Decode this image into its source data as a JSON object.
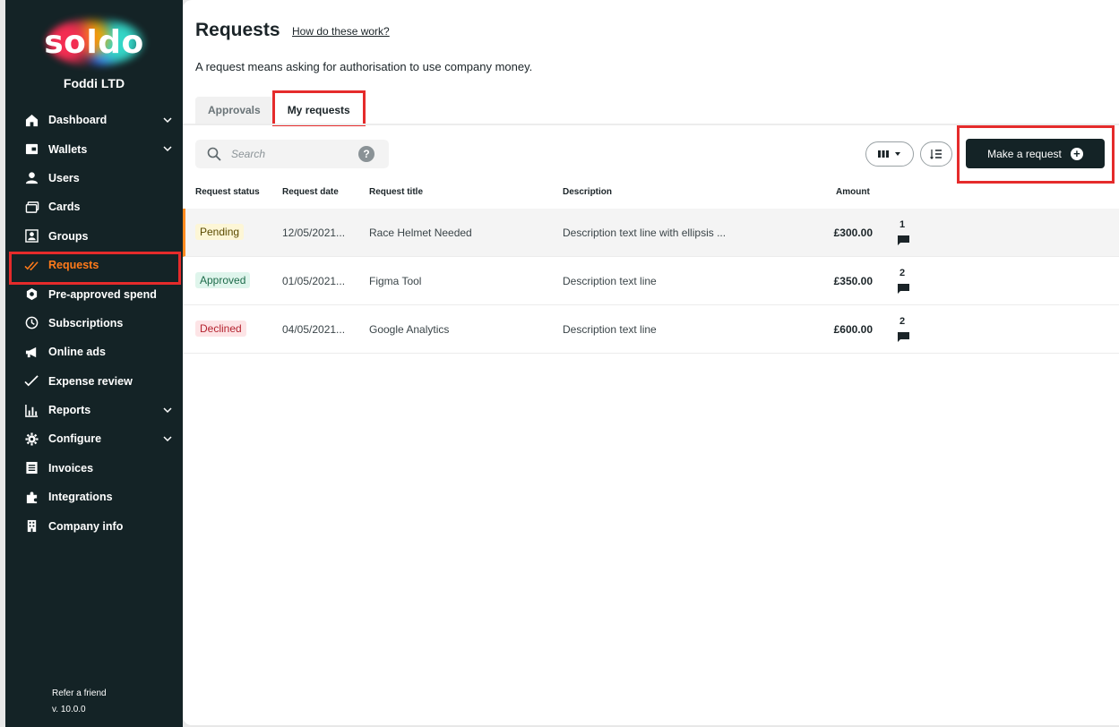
{
  "brand": {
    "logo_text": "soldo",
    "company": "Foddi LTD"
  },
  "sidebar": {
    "items": [
      {
        "label": "Dashboard",
        "icon": "home-icon",
        "has_chevron": true
      },
      {
        "label": "Wallets",
        "icon": "wallet-icon",
        "has_chevron": true
      },
      {
        "label": "Users",
        "icon": "user-icon",
        "has_chevron": false
      },
      {
        "label": "Cards",
        "icon": "cards-icon",
        "has_chevron": false
      },
      {
        "label": "Groups",
        "icon": "groups-icon",
        "has_chevron": false
      },
      {
        "label": "Requests",
        "icon": "double-check-icon",
        "has_chevron": false,
        "active": true
      },
      {
        "label": "Pre-approved spend",
        "icon": "hexagon-icon",
        "has_chevron": false
      },
      {
        "label": "Subscriptions",
        "icon": "clock-icon",
        "has_chevron": false
      },
      {
        "label": "Online ads",
        "icon": "megaphone-icon",
        "has_chevron": false
      },
      {
        "label": "Expense review",
        "icon": "check-icon",
        "has_chevron": false
      },
      {
        "label": "Reports",
        "icon": "bar-chart-icon",
        "has_chevron": true
      },
      {
        "label": "Configure",
        "icon": "gear-icon",
        "has_chevron": true
      },
      {
        "label": "Invoices",
        "icon": "invoice-icon",
        "has_chevron": false
      },
      {
        "label": "Integrations",
        "icon": "puzzle-icon",
        "has_chevron": false
      },
      {
        "label": "Company info",
        "icon": "building-icon",
        "has_chevron": false
      }
    ],
    "footer": {
      "refer": "Refer a friend",
      "version": "v. 10.0.0"
    }
  },
  "header": {
    "title": "Requests",
    "help_link": "How do these work?",
    "subtitle": "A request means asking for authorisation to use company money."
  },
  "tabs": [
    {
      "label": "Approvals",
      "active": false
    },
    {
      "label": "My requests",
      "active": true
    }
  ],
  "toolbar": {
    "search_placeholder": "Search",
    "help_glyph": "?",
    "make_request_label": "Make a request"
  },
  "table": {
    "columns": [
      "Request status",
      "Request date",
      "Request title",
      "Description",
      "Amount"
    ],
    "rows": [
      {
        "status": "Pending",
        "date": "12/05/2021...",
        "title": "Race Helmet Needed",
        "description": "Description text line with ellipsis ...",
        "amount": "£300.00",
        "comments": "1"
      },
      {
        "status": "Approved",
        "date": "01/05/2021...",
        "title": "Figma Tool",
        "description": "Description text line",
        "amount": "£350.00",
        "comments": "2"
      },
      {
        "status": "Declined",
        "date": "04/05/2021...",
        "title": "Google Analytics",
        "description": "Description text line",
        "amount": "£600.00",
        "comments": "2"
      }
    ]
  },
  "colors": {
    "sidebar_bg": "#142326",
    "accent_orange": "#ff7a1a",
    "highlight_red": "#e52b2b",
    "pending_bg": "#fdf6d6",
    "approved_bg": "#dff5ec",
    "declined_bg": "#fde4e6"
  }
}
